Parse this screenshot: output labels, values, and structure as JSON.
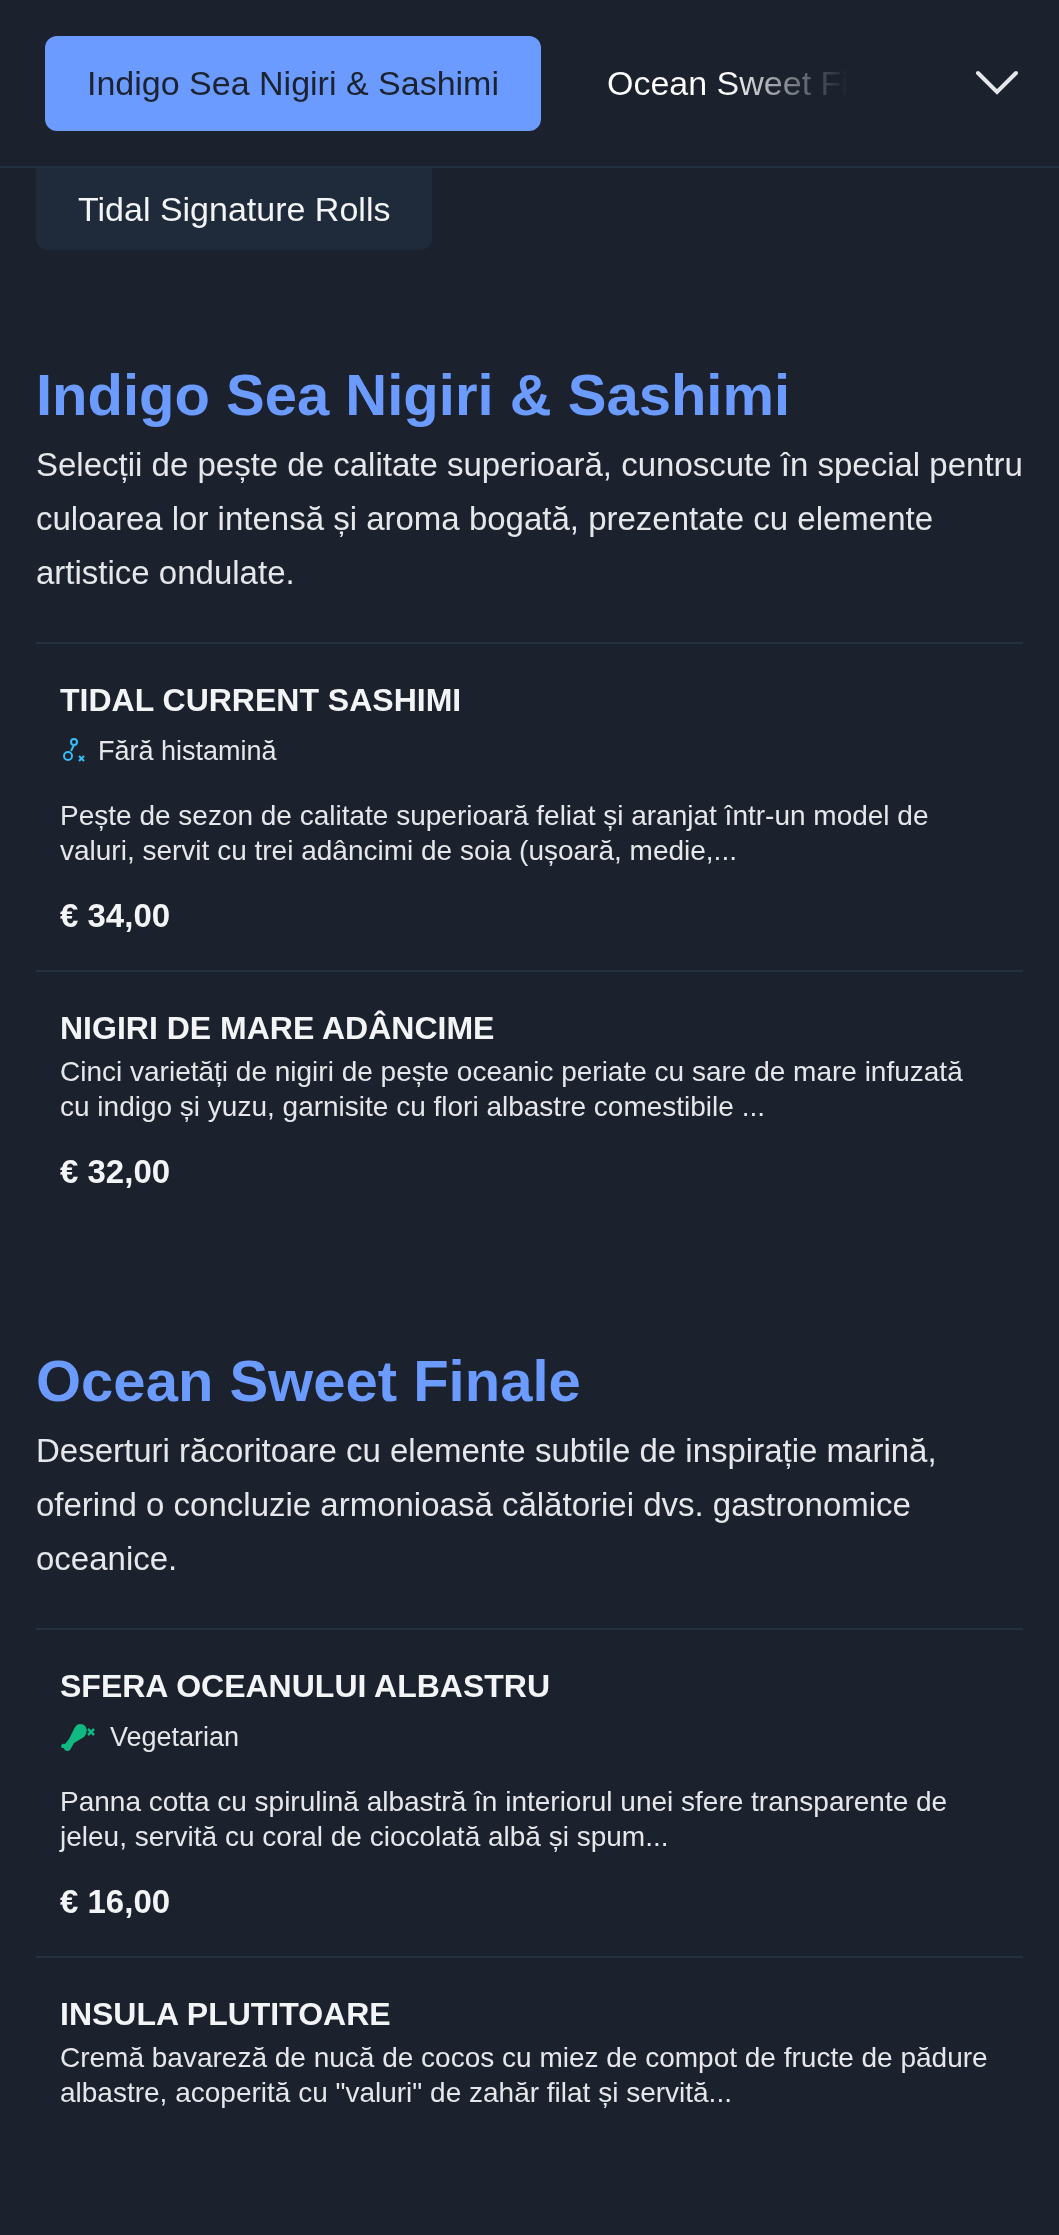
{
  "tabs": [
    {
      "label": "Indigo Sea Nigiri & Sashimi",
      "selected": true
    },
    {
      "label": "Ocean Sweet Fi",
      "selected": false
    }
  ],
  "category_chip": {
    "label": "Tidal Signature Rolls"
  },
  "sections": [
    {
      "title": "Indigo Sea Nigiri & Sashimi",
      "description": "Selecții de pește de calitate superioară, cunoscute în special pentru culoarea lor intensă și aroma bogată, prezentate cu elemente artistice ondulate.",
      "items": [
        {
          "name": "TIDAL CURRENT SASHIMI",
          "badges": [
            {
              "kind": "histamine",
              "label": "Fără histamină"
            }
          ],
          "description": "Pește de sezon de calitate superioară feliat și aranjat într-un model de valuri, servit cu trei adâncimi de soia (ușoară, medie,...",
          "price": "€ 34,00"
        },
        {
          "name": "NIGIRI DE MARE ADÂNCIME",
          "description": "Cinci varietăți de nigiri de pește oceanic periate cu sare de mare infuzată cu indigo și yuzu, garnisite cu flori albastre comestibile ...",
          "price": "€ 32,00"
        }
      ]
    },
    {
      "title": "Ocean Sweet Finale",
      "description": "Deserturi răcoritoare cu elemente subtile de inspirație marină, oferind o concluzie armonioasă călătoriei dvs. gastronomice oceanice.",
      "items": [
        {
          "name": "SFERA OCEANULUI ALBASTRU",
          "badges": [
            {
              "kind": "vegetarian",
              "label": "Vegetarian"
            }
          ],
          "description": "Panna cotta cu spirulină albastră în interiorul unei sfere transparente de jeleu, servită cu coral de ciocolată albă și spum...",
          "price": "€ 16,00"
        },
        {
          "name": "INSULA PLUTITOARE",
          "description": "Cremă bavareză de nucă de cocos cu miez de compot de fructe de pădure albastre, acoperită cu \"valuri\" de zahăr filat și servită..."
        }
      ]
    }
  ]
}
